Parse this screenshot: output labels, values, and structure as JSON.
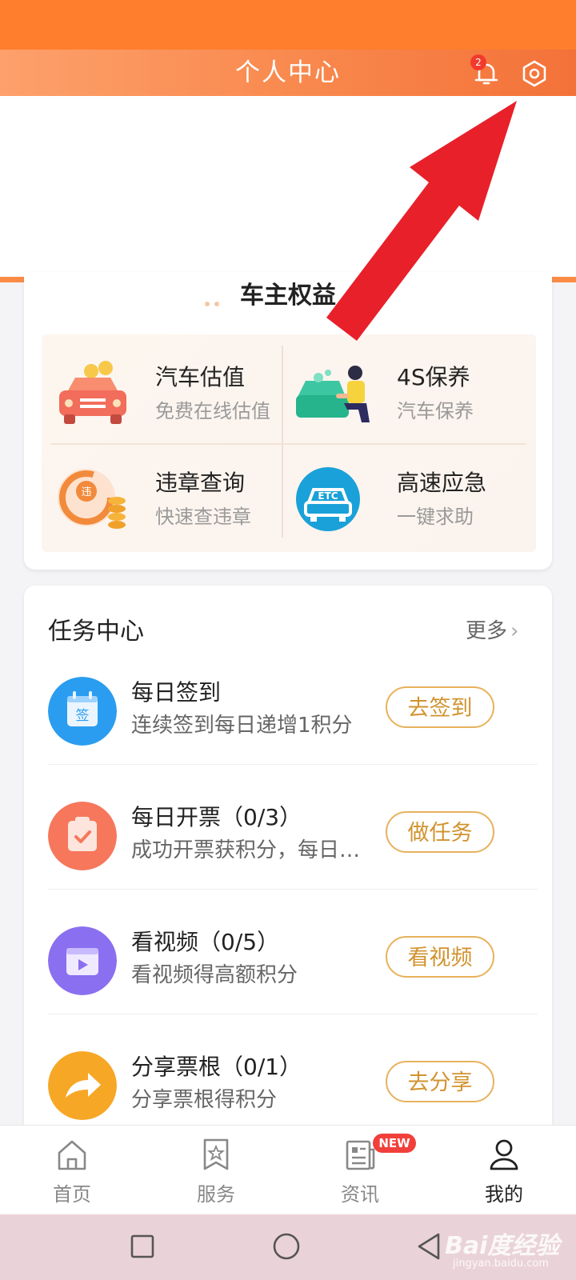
{
  "header": {
    "title": "个人中心",
    "notification_count": "2",
    "bell_icon": "bell-icon",
    "settings_icon": "gear-icon"
  },
  "rights": {
    "title": "车主权益",
    "items": [
      {
        "title": "汽车估值",
        "subtitle": "免费在线估值",
        "icon": "car-valuation-icon"
      },
      {
        "title": "4S保养",
        "subtitle": "汽车保养",
        "icon": "car-maintenance-icon"
      },
      {
        "title": "违章查询",
        "subtitle": "快速查违章",
        "icon": "violation-icon"
      },
      {
        "title": "高速应急",
        "subtitle": "一键求助",
        "icon": "etc-car-icon"
      }
    ]
  },
  "tasks": {
    "title": "任务中心",
    "more_label": "更多",
    "items": [
      {
        "title": "每日签到",
        "desc": "连续签到每日递增1积分",
        "button": "去签到",
        "icon": "sign-in-calendar-icon",
        "color": "#2a9df0"
      },
      {
        "title": "每日开票（0/3）",
        "desc": "成功开票获积分，每日…",
        "button": "做任务",
        "icon": "invoice-icon",
        "color": "#f6775b"
      },
      {
        "title": "看视频（0/5）",
        "desc": "看视频得高额积分",
        "button": "看视频",
        "icon": "video-icon",
        "color": "#8a6ff0"
      },
      {
        "title": "分享票根（0/1）",
        "desc": "分享票根得积分",
        "button": "去分享",
        "icon": "share-icon",
        "color": "#f7a726"
      }
    ]
  },
  "tabs": [
    {
      "label": "首页",
      "icon": "home-icon"
    },
    {
      "label": "服务",
      "icon": "bookmark-star-icon"
    },
    {
      "label": "资讯",
      "icon": "news-icon",
      "badge": "NEW"
    },
    {
      "label": "我的",
      "icon": "person-icon",
      "active": true
    }
  ],
  "watermark": {
    "main": "Bai度经验",
    "sub": "jingyan.baidu.com"
  },
  "colors": {
    "accent": "#fe7e2e",
    "button_text": "#d1932f",
    "annotation_arrow": "#e8202a"
  }
}
